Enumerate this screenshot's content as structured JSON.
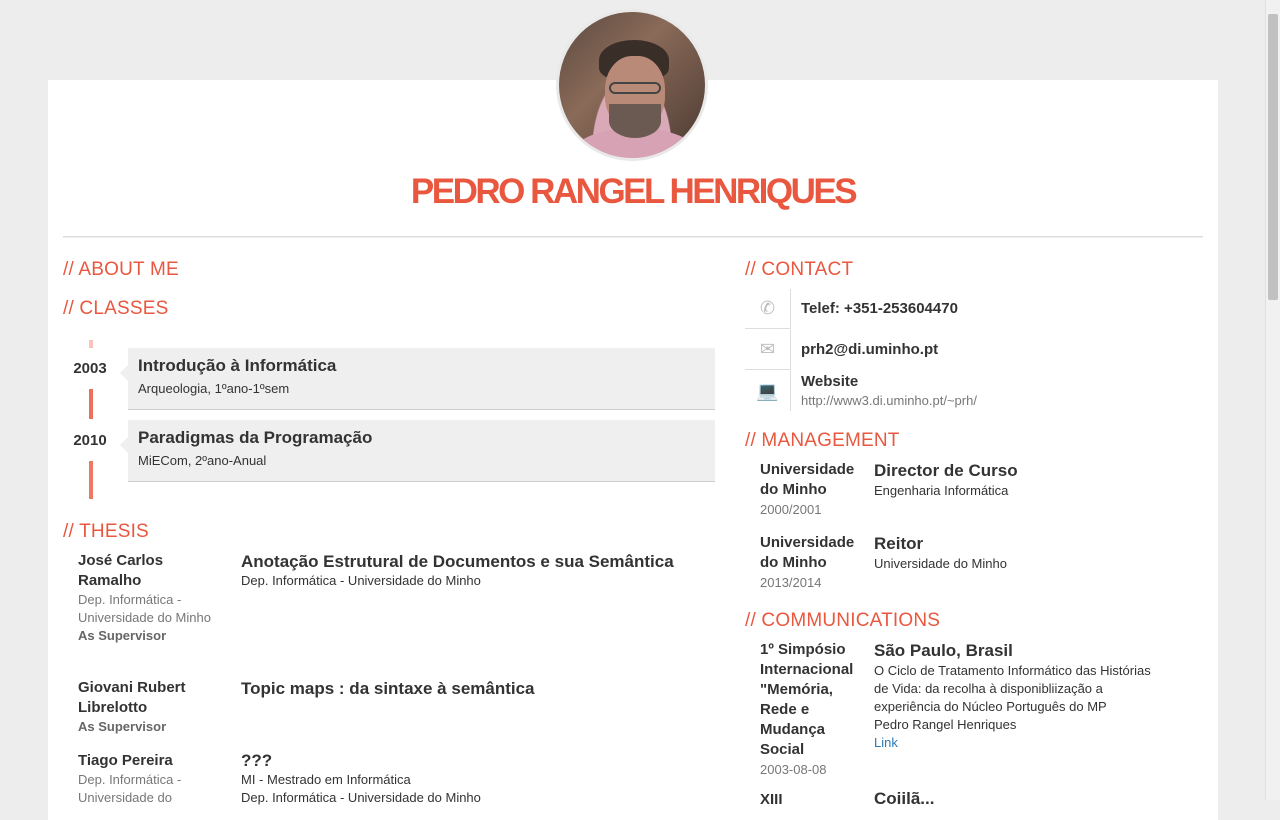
{
  "profile": {
    "name": "PEDRO RANGEL HENRIQUES"
  },
  "sections": {
    "about": "// ABOUT ME",
    "classes": "// CLASSES",
    "thesis": "// THESIS",
    "contact": "// CONTACT",
    "management": "// MANAGEMENT",
    "communications": "// COMMUNICATIONS"
  },
  "classes": [
    {
      "year": "2003",
      "title": "Introdução à Informática",
      "sub": "Arqueologia, 1ºano-1ºsem"
    },
    {
      "year": "2010",
      "title": "Paradigmas da Programação",
      "sub": "MiECom, 2ºano-Anual"
    }
  ],
  "thesis": [
    {
      "student": "José Carlos Ramalho",
      "affiliation": "Dep. Informática - Universidade do Minho",
      "role": "As Supervisor",
      "title": "Anotação Estrutural de Documentos e sua Semântica",
      "lines": [
        "Dep. Informática - Universidade do Minho"
      ]
    },
    {
      "student": "Giovani Rubert Librelotto",
      "affiliation": "",
      "role": "As Supervisor",
      "title": "Topic maps : da sintaxe à semântica",
      "lines": []
    },
    {
      "student": "Tiago Pereira",
      "affiliation": "Dep. Informática - Universidade do",
      "role": "",
      "title": "???",
      "lines": [
        "MI - Mestrado em Informática",
        "Dep. Informática - Universidade do Minho"
      ]
    }
  ],
  "contact": {
    "phone": "Telef: +351-253604470",
    "email": "prh2@di.uminho.pt",
    "website_label": "Website",
    "website_url": "http://www3.di.uminho.pt/~prh/",
    "icons": [
      "phone-icon",
      "envelope-icon",
      "laptop-icon"
    ]
  },
  "management": [
    {
      "org": "Universidade do Minho",
      "year": "2000/2001",
      "role": "Director de Curso",
      "detail": "Engenharia Informática"
    },
    {
      "org": "Universidade do Minho",
      "year": "2013/2014",
      "role": "Reitor",
      "detail": "Universidade do Minho"
    }
  ],
  "communications": [
    {
      "event": "1º Simpósio Internacional \"Memória, Rede e Mudança Social",
      "date": "2003-08-08",
      "place": "São Paulo, Brasil",
      "title": "O Ciclo de Tratamento Informático das Histórias de Vida: da recolha à disponibliização a experiência do Núcleo Português do MP",
      "author": "Pedro Rangel Henriques",
      "link": "Link"
    },
    {
      "event": "XIII",
      "place": "Coiilã..."
    }
  ],
  "colors": {
    "accent": "#e9573f",
    "background": "#ededed",
    "card": "#ffffff"
  }
}
